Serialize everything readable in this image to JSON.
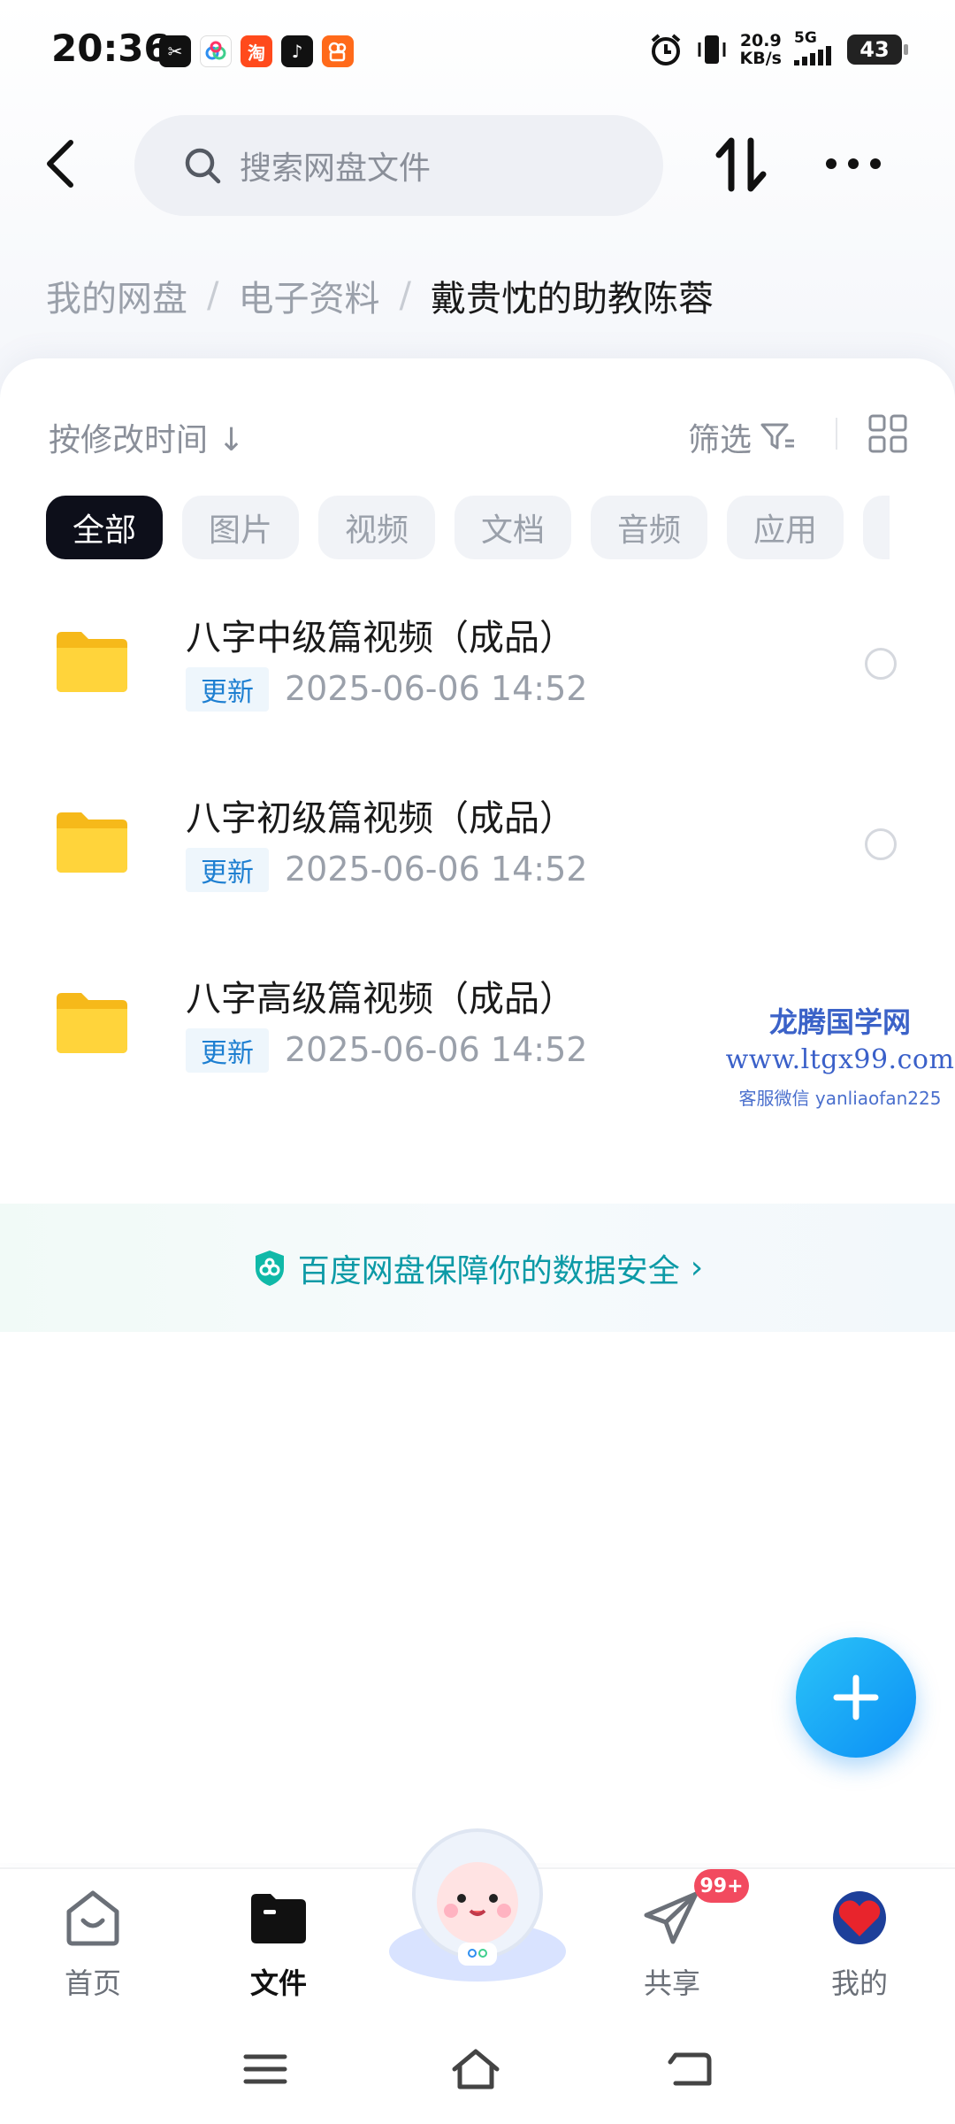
{
  "status_bar": {
    "time": "20:36",
    "app_icons": [
      "capcut-icon",
      "baidu-netdisk-icon",
      "taobao-icon",
      "tiktok-icon",
      "kuaishou-icon"
    ],
    "net_speed_value": "20.9",
    "net_speed_unit": "KB/s",
    "network": "5G",
    "battery": "43"
  },
  "top_bar": {
    "search_placeholder": "搜索网盘文件"
  },
  "breadcrumb": {
    "items": [
      "我的网盘",
      "电子资料"
    ],
    "separator": "/",
    "current": "戴贵忱的助教陈蓉"
  },
  "toolbar": {
    "sort_label": "按修改时间",
    "sort_arrow": "↓",
    "filter_label": "筛选"
  },
  "chips": [
    "全部",
    "图片",
    "视频",
    "文档",
    "音频",
    "应用"
  ],
  "files": [
    {
      "name": "八字中级篇视频（成品）",
      "badge": "更新",
      "time": "2025-06-06  14:52"
    },
    {
      "name": "八字初级篇视频（成品）",
      "badge": "更新",
      "time": "2025-06-06  14:52"
    },
    {
      "name": "八字高级篇视频（成品）",
      "badge": "更新",
      "time": "2025-06-06  14:52"
    }
  ],
  "watermark": {
    "line1": "龙腾国学网",
    "line2": "www.ltgx99.com",
    "line3": "客服微信 yanliaofan225"
  },
  "security_banner": {
    "text": "百度网盘保障你的数据安全",
    "chevron": "›"
  },
  "bottom_nav": {
    "home": "首页",
    "files": "文件",
    "share": "共享",
    "mine": "我的",
    "share_badge": "99+"
  },
  "colors": {
    "accent": "#0b8ef5",
    "security_text": "#0c9aa6",
    "badge_red": "#f24a5f",
    "folder_yellow": "#ffcf2e"
  }
}
